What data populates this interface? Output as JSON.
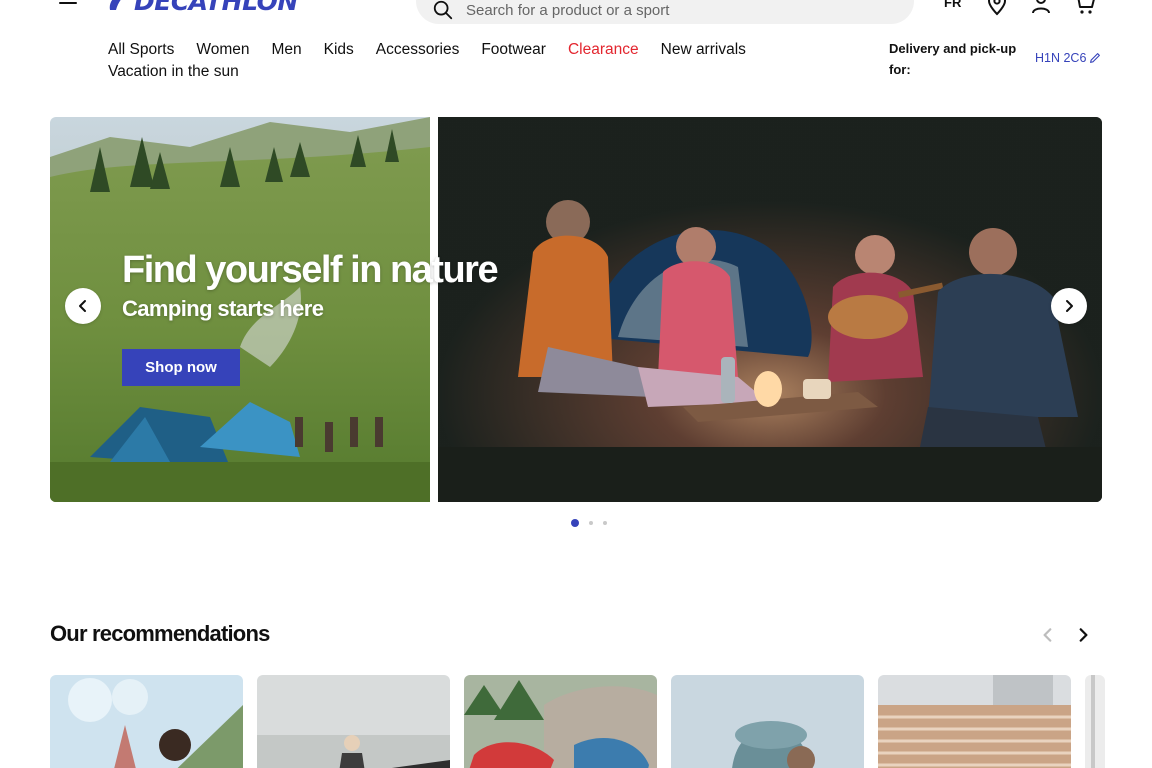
{
  "header": {
    "logo_text": "DECATHLON",
    "search_placeholder": "Search for a product or a sport",
    "language": "FR",
    "icons": [
      "menu-icon",
      "search-icon",
      "store-locator-icon",
      "account-icon",
      "cart-icon"
    ]
  },
  "nav": {
    "items": [
      "All Sports",
      "Women",
      "Men",
      "Kids",
      "Accessories",
      "Footwear",
      "Clearance",
      "New arrivals"
    ],
    "second_row": "Vacation in the sun",
    "highlight_color": "#e3262f"
  },
  "delivery": {
    "label": "Delivery and pick-up for:",
    "postal_code": "H1N 2C6"
  },
  "hero": {
    "title": "Find yourself in nature",
    "subtitle": "Camping starts here",
    "cta": "Shop now",
    "slides_count": 3,
    "active_slide": 1
  },
  "recommendations": {
    "title": "Our recommendations"
  },
  "colors": {
    "brand": "#3643ba",
    "accent_red": "#e3262f"
  }
}
